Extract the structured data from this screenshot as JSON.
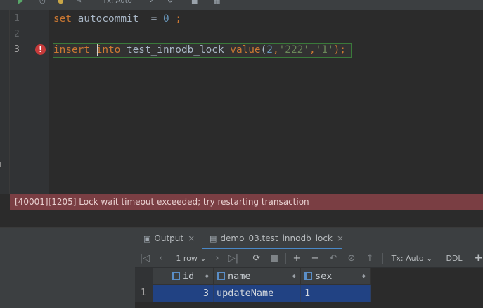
{
  "editor": {
    "line_numbers": [
      "1",
      "2",
      "3"
    ],
    "line1": {
      "set": "set",
      "name": "autocommit",
      "eq": "=",
      "value": "0",
      "semi": ";"
    },
    "line3": {
      "insert": "insert",
      "into": "into",
      "table": "test_innodb_lock",
      "value_kw": "value",
      "open": "(",
      "num": "2",
      "comma1": ",",
      "s1": "'222'",
      "comma2": ",",
      "s2": "'1'",
      "close": ");"
    },
    "error_icon": "error-icon"
  },
  "error_message": "[40001][1205] Lock wait timeout exceeded; try restarting transaction",
  "results": {
    "tabs": [
      {
        "label": "Output",
        "icon": "output-icon"
      },
      {
        "label": "demo_03.test_innodb_lock",
        "icon": "table-icon"
      }
    ],
    "toolbar": {
      "row_count": "1 row",
      "tx_mode": "Tx: Auto",
      "ddl": "DDL"
    },
    "columns": [
      "id",
      "name",
      "sex"
    ],
    "rows": [
      {
        "row_number": "1",
        "id": "3",
        "name": "updateName",
        "sex": "1"
      }
    ]
  },
  "top_toolbar": {
    "tx_mode": "Tx: Auto"
  },
  "colors": {
    "keyword": "#cc7832",
    "number": "#6897bb",
    "string": "#6a8759",
    "error_bar": "#7a3e43",
    "selection": "#214283"
  }
}
